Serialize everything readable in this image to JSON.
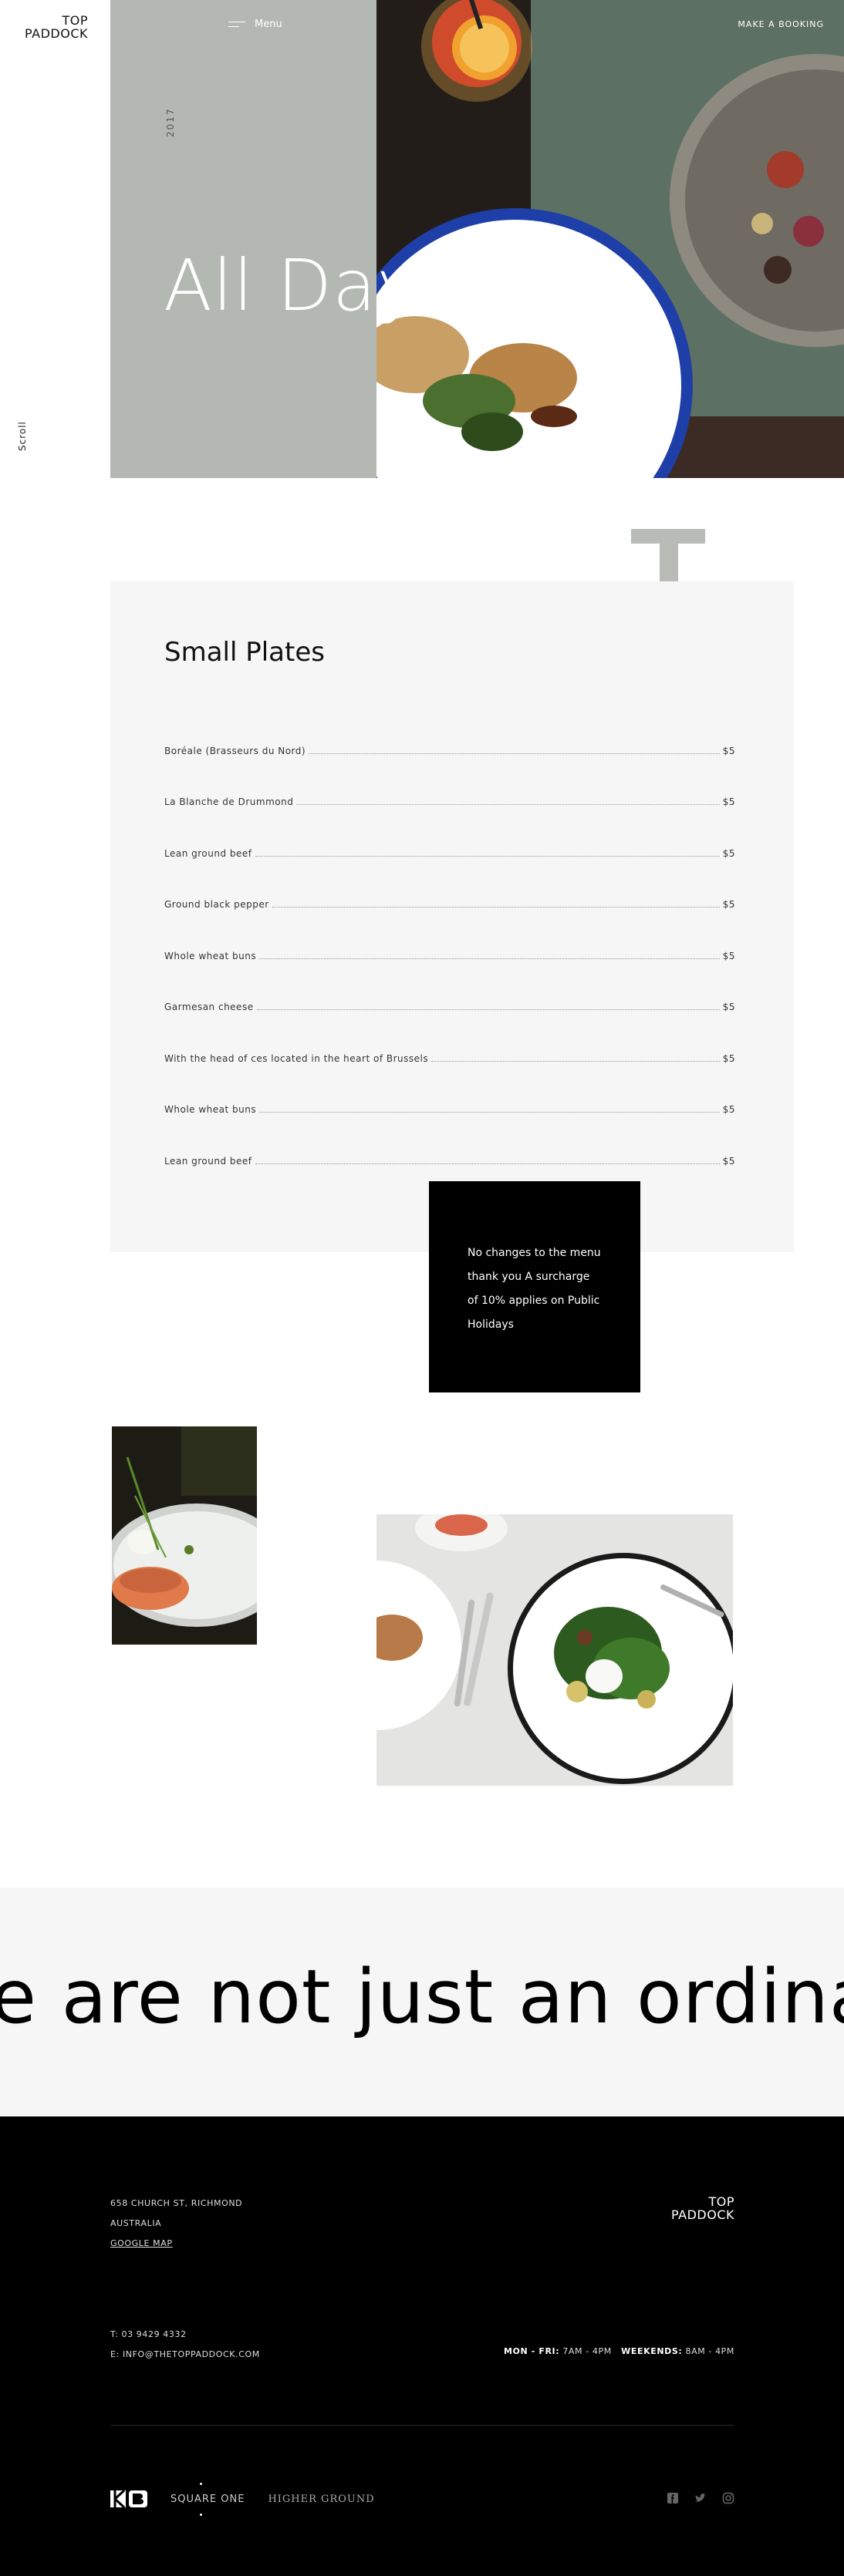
{
  "header": {
    "logo_line1": "TOP",
    "logo_line2": "PADDOCK",
    "menu_label": "Menu",
    "booking_label": "MAKE A BOOKING"
  },
  "hero": {
    "year": "2017",
    "title": "All Day Menu",
    "scroll_label": "Scroll"
  },
  "menu": {
    "section_title": "Small Plates",
    "items": [
      {
        "name": "Boréale (Brasseurs du Nord)",
        "price": "$5"
      },
      {
        "name": "La Blanche de Drummond",
        "price": "$5"
      },
      {
        "name": "Lean ground beef",
        "price": "$5"
      },
      {
        "name": "Ground black pepper",
        "price": "$5"
      },
      {
        "name": "Whole wheat buns",
        "price": "$5"
      },
      {
        "name": "Garmesan cheese",
        "price": "$5"
      },
      {
        "name": "With the head of ces located in the heart of Brussels",
        "price": "$5"
      },
      {
        "name": "Whole wheat buns",
        "price": "$5"
      },
      {
        "name": "Lean ground beef",
        "price": "$5"
      }
    ],
    "note": "No changes to the menu thank you A surcharge of 10% applies on Public Holidays"
  },
  "marquee": {
    "text": "e are not just an ordina"
  },
  "footer": {
    "address_line1": "658 CHURCH ST, RICHMOND",
    "address_line2": "AUSTRALIA",
    "map_link": "GOOGLE MAP",
    "logo_line1": "TOP",
    "logo_line2": "PADDOCK",
    "phone": "T: 03 9429 4332",
    "email": "E: INFO@THETOPPADDOCK.COM",
    "hours_weekday_label": "MON - FRI:",
    "hours_weekday": "7AM - 4PM",
    "hours_weekend_label": "WEEKENDS:",
    "hours_weekend": "8AM - 4PM",
    "brands": [
      "SQUARE ONE",
      "HIGHER GROUND"
    ],
    "social": [
      "facebook-icon",
      "twitter-icon",
      "instagram-icon"
    ]
  },
  "colors": {
    "hero_panel": "#b4b8b3",
    "card_bg": "#f6f6f6",
    "footer_bg": "#000000",
    "plate_rim": "#1f3fa8"
  }
}
